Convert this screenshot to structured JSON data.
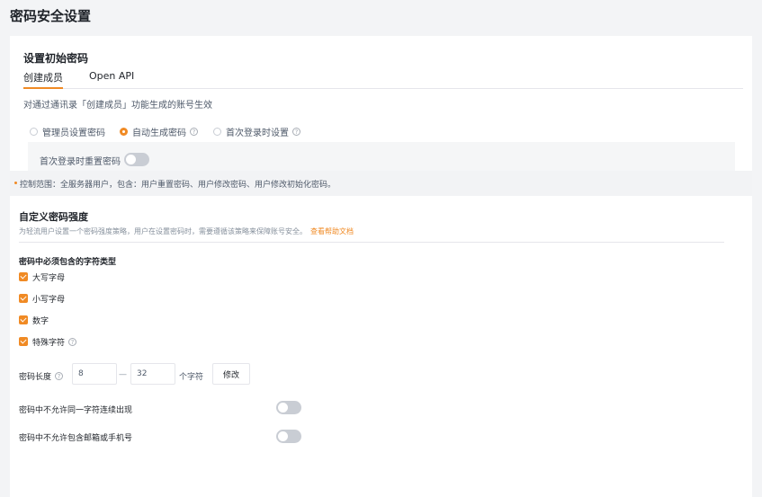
{
  "page": {
    "title": "密码安全设置"
  },
  "initial_password": {
    "title": "设置初始密码",
    "tabs": [
      {
        "label": "创建成员",
        "active": true
      },
      {
        "label": "Open API",
        "active": false
      }
    ],
    "description": "对通过通讯录「创建成员」功能生成的账号生效",
    "radio_options": [
      {
        "label": "管理员设置密码",
        "checked": false,
        "help": false
      },
      {
        "label": "自动生成密码",
        "checked": true,
        "help": true
      },
      {
        "label": "首次登录时设置",
        "checked": false,
        "help": true
      }
    ],
    "reset_on_first_login": {
      "label": "首次登录时重置密码",
      "enabled": false
    }
  },
  "scope": {
    "text": "控制范围：全服务器用户，包含：用户重置密码、用户修改密码、用户修改初始化密码。"
  },
  "strength": {
    "title": "自定义密码强度",
    "description": "为轻流用户设置一个密码强度策略，用户在设置密码时，需要遵循该策略来保障账号安全。",
    "help_link": "查看帮助文档",
    "char_types_title": "密码中必须包含的字符类型",
    "char_types": [
      {
        "label": "大写字母",
        "checked": true,
        "help": false
      },
      {
        "label": "小写字母",
        "checked": true,
        "help": false
      },
      {
        "label": "数字",
        "checked": true,
        "help": false
      },
      {
        "label": "特殊字符",
        "checked": true,
        "help": true
      }
    ],
    "length": {
      "label": "密码长度",
      "min": "8",
      "max": "32",
      "separator": "—",
      "unit": "个字符",
      "modify_label": "修改"
    },
    "rules": [
      {
        "label": "密码中不允许同一字符连续出现",
        "enabled": false
      },
      {
        "label": "密码中不允许包含邮箱或手机号",
        "enabled": false
      }
    ]
  },
  "colors": {
    "accent": "#f08a24",
    "background": "#f3f4f6",
    "toggle_off": "#c9cdd4"
  },
  "icons": {
    "help": "question-circle-icon",
    "check": "checkbox-check-icon"
  }
}
